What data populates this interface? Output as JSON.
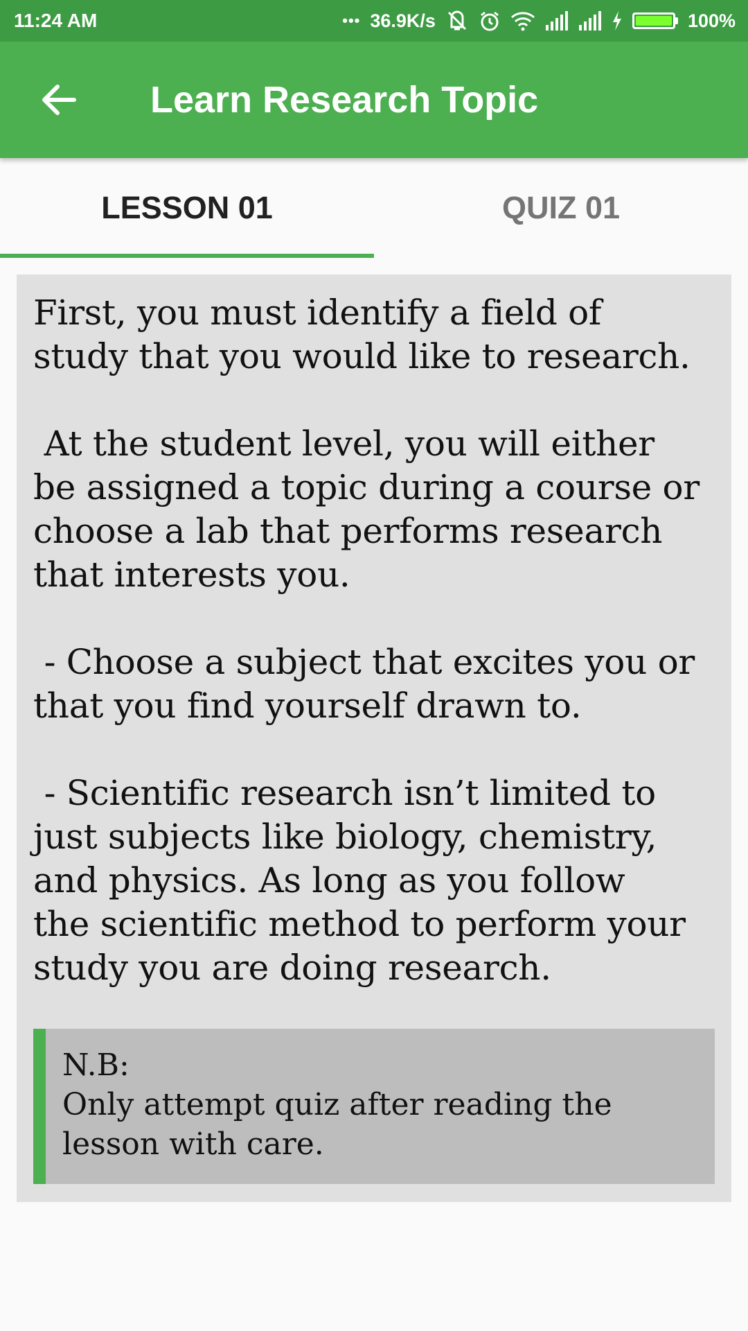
{
  "status_bar": {
    "time": "11:24 AM",
    "dots": "•••",
    "network_speed": "36.9K/s",
    "battery_percent": "100%",
    "icons": [
      "vibrate-off-icon",
      "alarm-icon",
      "wifi-icon",
      "signal-icon",
      "signal-icon",
      "charging-icon",
      "battery-icon"
    ]
  },
  "app_bar": {
    "title": "Learn Research Topic",
    "back_icon": "arrow-left-icon"
  },
  "tabs": [
    {
      "label": "LESSON 01",
      "selected": true
    },
    {
      "label": "QUIZ 01",
      "selected": false
    }
  ],
  "lesson": {
    "body": "First, you must identify a field of\nstudy that you would like to research.\n\n At the student level, you will either\nbe assigned a topic during a course or\nchoose a lab that performs research\nthat interests you.\n\n - Choose a subject that excites you or\nthat you find yourself drawn to.\n\n - Scientific research isn’t limited to\njust subjects like biology, chemistry,\nand physics. As long as you follow\nthe scientific method to perform your\nstudy you are doing research.",
    "note": "N.B:\nOnly attempt quiz after reading the\nlesson with care."
  },
  "colors": {
    "status_bar": "#3c9b43",
    "primary": "#4caf50",
    "card_background": "#e0e0e0",
    "note_background": "#bdbdbd",
    "tab_selected_text": "#212121",
    "tab_unselected_text": "#757575"
  }
}
